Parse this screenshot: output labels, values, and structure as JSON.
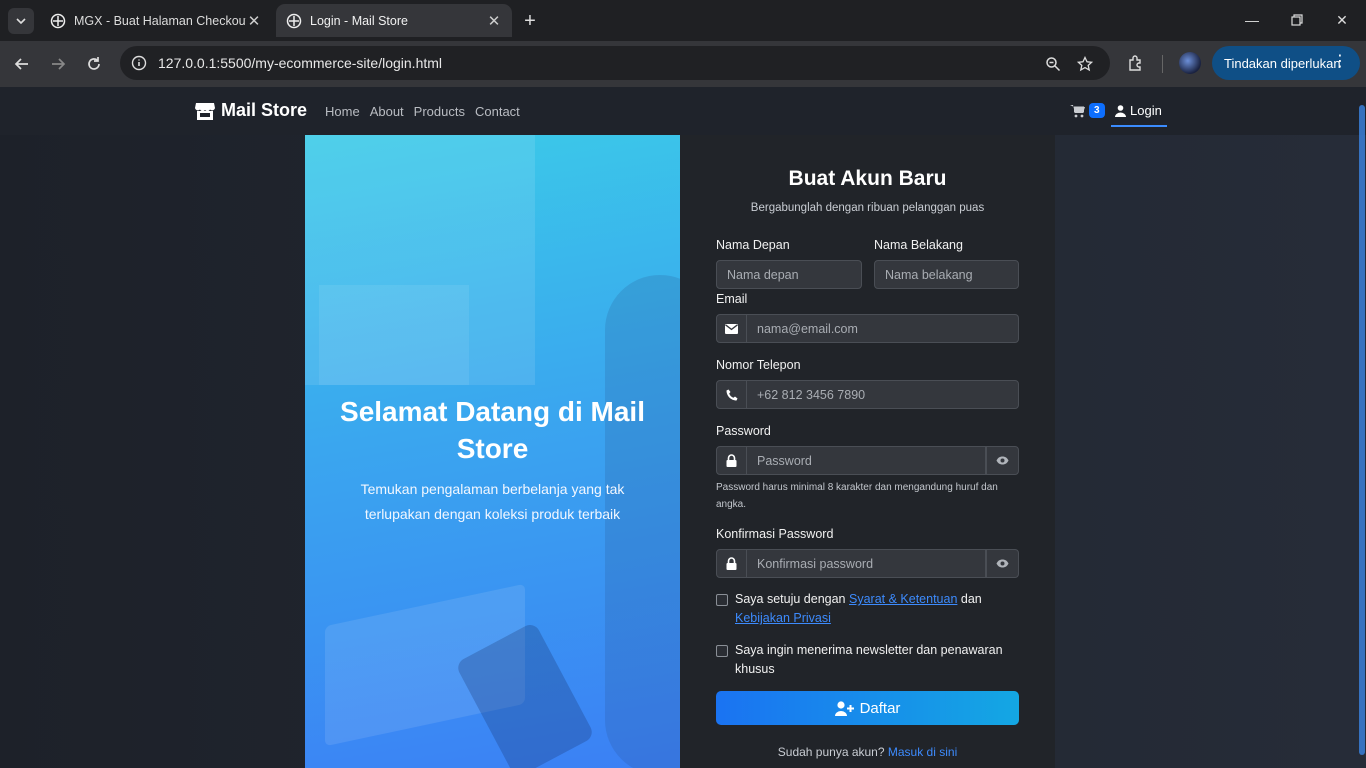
{
  "browser": {
    "tabs": [
      {
        "title": "MGX - Buat Halaman Checkout",
        "active": false
      },
      {
        "title": "Login - Mail Store",
        "active": true
      }
    ],
    "url": "127.0.0.1:5500/my-ecommerce-site/login.html",
    "action_pill": "Tindakan diperlukan"
  },
  "navbar": {
    "brand": "Mail Store",
    "links": [
      "Home",
      "About",
      "Products",
      "Contact"
    ],
    "cart_count": "3",
    "login": "Login"
  },
  "hero": {
    "title": "Selamat Datang di Mail Store",
    "text": "Temukan pengalaman berbelanja yang tak terlupakan dengan koleksi produk terbaik"
  },
  "form": {
    "title": "Buat Akun Baru",
    "subtitle": "Bergabunglah dengan ribuan pelanggan puas",
    "first_name_label": "Nama Depan",
    "first_name_placeholder": "Nama depan",
    "last_name_label": "Nama Belakang",
    "last_name_placeholder": "Nama belakang",
    "email_label": "Email",
    "email_placeholder": "nama@email.com",
    "phone_label": "Nomor Telepon",
    "phone_placeholder": "+62 812 3456 7890",
    "password_label": "Password",
    "password_placeholder": "Password",
    "password_hint": "Password harus minimal 8 karakter dan mengandung huruf dan angka.",
    "confirm_label": "Konfirmasi Password",
    "confirm_placeholder": "Konfirmasi password",
    "terms_prefix": "Saya setuju dengan",
    "terms_link": "Syarat & Ketentuan",
    "terms_mid": "dan",
    "privacy_link": "Kebijakan Privasi",
    "newsletter": "Saya ingin menerima newsletter dan penawaran khusus",
    "submit": "Daftar",
    "have_account": "Sudah punya akun?",
    "login_link": "Masuk di sini"
  },
  "colors": {
    "accent": "#0d6efd",
    "hero_gradient_start": "#3bcbe8",
    "hero_gradient_end": "#3b7ff5",
    "card_bg": "#212429"
  }
}
